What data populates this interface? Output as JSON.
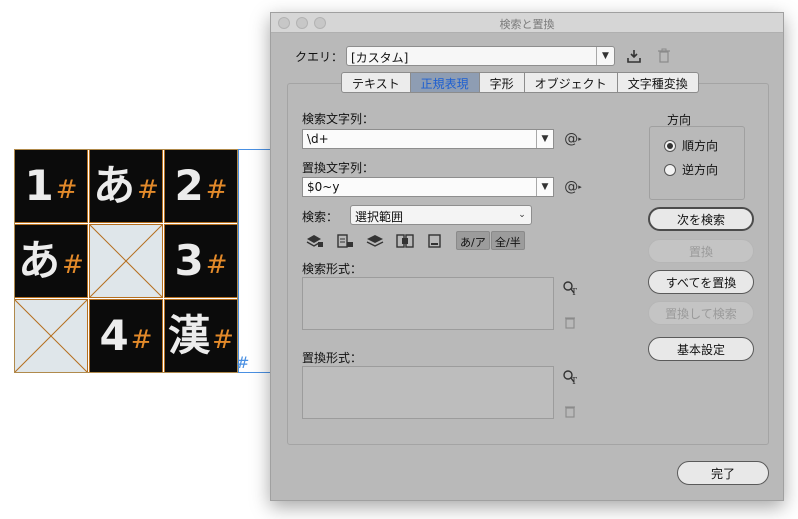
{
  "artwork": {
    "cells": [
      {
        "glyph": "1",
        "hash": "#"
      },
      {
        "glyph": "あ",
        "hash": "#"
      },
      {
        "glyph": "2",
        "hash": "#"
      },
      {
        "glyph": "あ",
        "hash": "#"
      },
      {
        "glyph": "",
        "hash": ""
      },
      {
        "glyph": "3",
        "hash": "#"
      },
      {
        "glyph": "",
        "hash": ""
      },
      {
        "glyph": "4",
        "hash": "#"
      },
      {
        "glyph": "漢",
        "hash": "#"
      }
    ],
    "overflow_mark": "#"
  },
  "dialog": {
    "title": "検索と置換",
    "query_label": "クエリ：",
    "query_value": "[カスタム]",
    "tabs": [
      "テキスト",
      "正規表現",
      "字形",
      "オブジェクト",
      "文字種変換"
    ],
    "active_tab": "正規表現",
    "find_label": "検索文字列：",
    "find_value": "\\d+",
    "change_label": "置換文字列：",
    "change_value": "$0~y",
    "search_label": "検索：",
    "search_value": "選択範囲",
    "toggle_kana": "あ/ア",
    "toggle_width": "全/半",
    "find_format_label": "検索形式：",
    "change_format_label": "置換形式：",
    "direction_label": "方向",
    "direction_forward": "順方向",
    "direction_backward": "逆方向",
    "btn_find_next": "次を検索",
    "btn_change": "置換",
    "btn_change_all": "すべてを置換",
    "btn_change_find": "置換して検索",
    "btn_basic": "基本設定",
    "btn_done": "完了",
    "special_char_symbol": "@"
  }
}
